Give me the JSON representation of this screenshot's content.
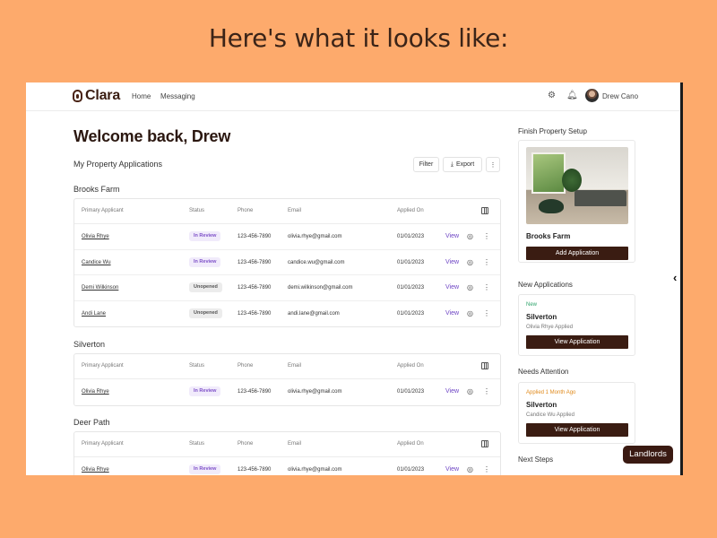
{
  "caption": "Here's what it looks like:",
  "nav": {
    "brand": "Clara",
    "links": [
      "Home",
      "Messaging"
    ],
    "user_name": "Drew Cano",
    "icons": [
      "settings-gear-icon",
      "bell-icon"
    ]
  },
  "main": {
    "welcome": "Welcome back, Drew",
    "subheading": "My Property Applications",
    "filter_label": "Filter",
    "export_label": "Export",
    "columns": [
      "Primary Applicant",
      "Status",
      "Phone",
      "Email",
      "Applied On"
    ],
    "view_label": "View",
    "groups": [
      {
        "title": "Brooks Farm",
        "rows": [
          {
            "name": "Olivia Rhye",
            "status": "In Review",
            "phone": "123-456-7890",
            "email": "olivia.rhye@gmail.com",
            "applied": "01/01/2023"
          },
          {
            "name": "Candice Wu",
            "status": "In Review",
            "phone": "123-456-7890",
            "email": "candice.wu@gmail.com",
            "applied": "01/01/2023"
          },
          {
            "name": "Demi Wilkinson",
            "status": "Unopened",
            "phone": "123-456-7890",
            "email": "demi.wilkinson@gmail.com",
            "applied": "01/01/2023"
          },
          {
            "name": "Andi Lane",
            "status": "Unopened",
            "phone": "123-456-7890",
            "email": "andi.lane@gmail.com",
            "applied": "01/01/2023"
          }
        ]
      },
      {
        "title": "Silverton",
        "rows": [
          {
            "name": "Olivia Rhye",
            "status": "In Review",
            "phone": "123-456-7890",
            "email": "olivia.rhye@gmail.com",
            "applied": "01/01/2023"
          }
        ]
      },
      {
        "title": "Deer Path",
        "rows": [
          {
            "name": "Olivia Rhye",
            "status": "In Review",
            "phone": "123-456-7890",
            "email": "olivia.rhye@gmail.com",
            "applied": "01/01/2023"
          }
        ]
      }
    ]
  },
  "right_panel": {
    "setup_title": "Finish Property Setup",
    "setup_property": "Brooks Farm",
    "add_application": "Add Application",
    "new_apps_title": "New Applications",
    "new_tag": "New",
    "new_property": "Silverton",
    "new_sub": "Olivia Rhye Applied",
    "view_application": "View Application",
    "attention_title": "Needs Attention",
    "attention_tag": "Applied 1 Month Ago",
    "attention_property": "Silverton",
    "attention_sub": "Candice Wu Applied",
    "next_steps_title": "Next Steps"
  },
  "fab_label": "Landlords",
  "colors": {
    "background": "#fdaa6c",
    "brand_dark": "#3a1c12",
    "link_purple": "#6d44c4",
    "review_badge": "#7d4fc8"
  }
}
